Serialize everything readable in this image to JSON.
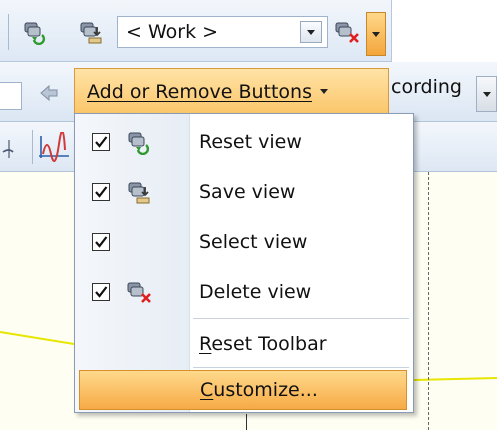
{
  "toolbar_top": {
    "combo_value": "< Work >"
  },
  "toolbar_second": {
    "add_remove_label": "Add or Remove Buttons",
    "recording_label": "cording"
  },
  "menu": {
    "items": [
      {
        "label": "Reset view",
        "checked": true,
        "icon": "reset-view-icon"
      },
      {
        "label": "Save view",
        "checked": true,
        "icon": "save-view-icon"
      },
      {
        "label": "Select view",
        "checked": true,
        "icon": ""
      },
      {
        "label": "Delete view",
        "checked": true,
        "icon": "delete-view-icon"
      }
    ],
    "reset_toolbar": {
      "underline": "R",
      "rest": "eset Toolbar"
    },
    "customize": {
      "underline": "C",
      "rest": "ustomize..."
    }
  },
  "colors": {
    "highlight": "#f6aa45",
    "toolbar_bg": "#dde8f5",
    "workspace": "#fffef2",
    "trace": "#e6e600"
  }
}
